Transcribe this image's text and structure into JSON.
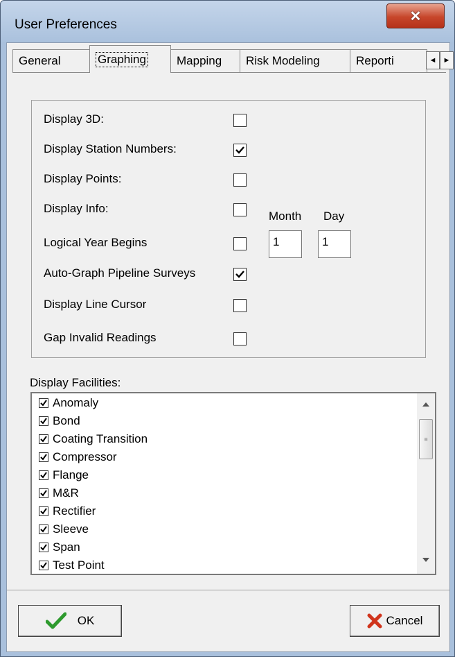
{
  "window": {
    "title": "User Preferences",
    "close_glyph": "✕"
  },
  "tabs": [
    {
      "label": "General"
    },
    {
      "label": "Graphing"
    },
    {
      "label": "Mapping"
    },
    {
      "label": "Risk Modeling"
    },
    {
      "label": "Reporti"
    }
  ],
  "tab_scroll": {
    "left": "◄",
    "right": "►"
  },
  "options": [
    {
      "label": "Display 3D:",
      "checked": false
    },
    {
      "label": "Display Station Numbers:",
      "checked": true
    },
    {
      "label": "Display Points:",
      "checked": false
    },
    {
      "label": "Display Info:",
      "checked": false
    },
    {
      "label": "Logical Year Begins",
      "checked": false
    },
    {
      "label": "Auto-Graph Pipeline Surveys",
      "checked": true
    },
    {
      "label": "Display Line Cursor",
      "checked": false
    },
    {
      "label": "Gap Invalid Readings",
      "checked": false
    }
  ],
  "logical_year": {
    "month_label": "Month",
    "day_label": "Day",
    "month_value": "1",
    "day_value": "1"
  },
  "facilities": {
    "label": "Display Facilities:",
    "items": [
      {
        "label": "Anomaly",
        "checked": true
      },
      {
        "label": "Bond",
        "checked": true
      },
      {
        "label": "Coating Transition",
        "checked": true
      },
      {
        "label": "Compressor",
        "checked": true
      },
      {
        "label": "Flange",
        "checked": true
      },
      {
        "label": "M&R",
        "checked": true
      },
      {
        "label": "Rectifier",
        "checked": true
      },
      {
        "label": "Sleeve",
        "checked": true
      },
      {
        "label": "Span",
        "checked": true
      },
      {
        "label": "Test Point",
        "checked": true
      }
    ]
  },
  "buttons": {
    "ok_label": "OK",
    "cancel_label": "Cancel"
  },
  "colors": {
    "ok_check": "#2e9a2e",
    "cancel_x": "#d0341c",
    "titlebar": "#aac1dd"
  }
}
